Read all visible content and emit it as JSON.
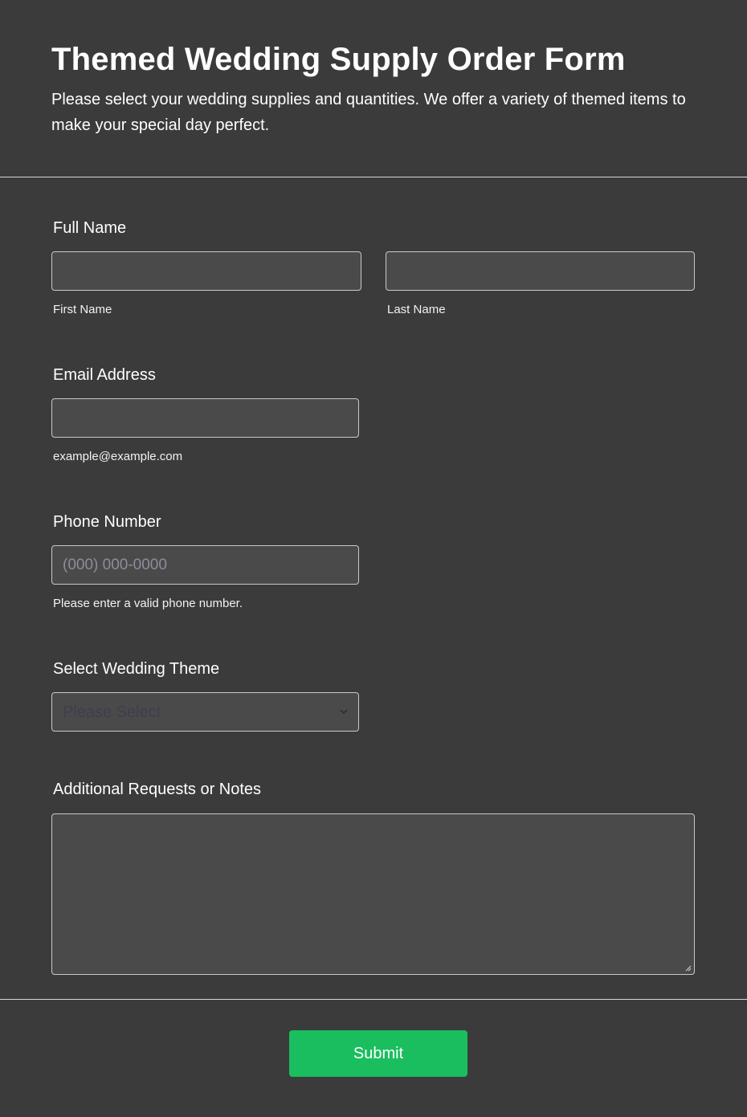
{
  "header": {
    "title": "Themed Wedding Supply Order Form",
    "subtitle": "Please select your wedding supplies and quantities. We offer a variety of themed items to make your special day perfect."
  },
  "full_name": {
    "label": "Full Name",
    "first_value": "",
    "first_sublabel": "First Name",
    "last_value": "",
    "last_sublabel": "Last Name"
  },
  "email": {
    "label": "Email Address",
    "value": "",
    "sublabel": "example@example.com"
  },
  "phone": {
    "label": "Phone Number",
    "value": "",
    "placeholder": "(000) 000-0000",
    "sublabel": "Please enter a valid phone number."
  },
  "theme": {
    "label": "Select Wedding Theme",
    "selected": "Please Select"
  },
  "notes": {
    "label": "Additional Requests or Notes",
    "value": ""
  },
  "submit": {
    "label": "Submit"
  },
  "colors": {
    "background": "#3b3b3b",
    "field_background": "#4a4a4a",
    "accent_button": "#1abe5e",
    "divider": "#d7d7d7"
  },
  "icons": {
    "select_arrow": "chevron-down-icon",
    "textarea_resize": "resize-handle-icon"
  }
}
